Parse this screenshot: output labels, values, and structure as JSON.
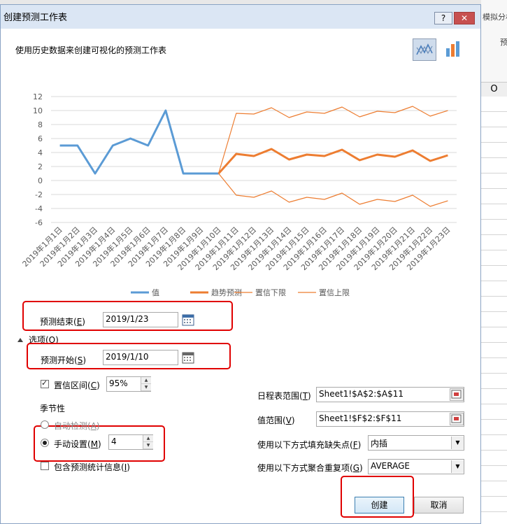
{
  "dialog": {
    "title": "创建预测工作表",
    "help_label": "?",
    "close_label": "✕",
    "subtitle": "使用历史数据来创建可视化的预测工作表"
  },
  "background": {
    "right_labels": [
      "模拟分析",
      "预"
    ],
    "column_header": "O"
  },
  "icons": {
    "line_chart": "line-chart-icon",
    "column_chart": "column-chart-icon",
    "calendar": "calendar-icon",
    "range_ref": "range-select-icon"
  },
  "colors": {
    "value_series": "#5b9bd5",
    "forecast_series": "#ed7d31",
    "highlight_box": "#e00000"
  },
  "chart_data": {
    "type": "line",
    "categories": [
      "2019年1月1日",
      "2019年1月2日",
      "2019年1月3日",
      "2019年1月4日",
      "2019年1月5日",
      "2019年1月6日",
      "2019年1月7日",
      "2019年1月8日",
      "2019年1月9日",
      "2019年1月10日",
      "2019年1月11日",
      "2019年1月12日",
      "2019年1月13日",
      "2019年1月14日",
      "2019年1月15日",
      "2019年1月16日",
      "2019年1月17日",
      "2019年1月18日",
      "2019年1月19日",
      "2019年1月20日",
      "2019年1月21日",
      "2019年1月22日",
      "2019年1月23日"
    ],
    "yticks": [
      "12",
      "10",
      "8",
      "6",
      "4",
      "2",
      "0",
      "-2",
      "-4",
      "-6"
    ],
    "ylim": [
      -6,
      12
    ],
    "series": [
      {
        "name": "值",
        "values": [
          5,
          5,
          1,
          5,
          6,
          5,
          10,
          1,
          1,
          1,
          null,
          null,
          null,
          null,
          null,
          null,
          null,
          null,
          null,
          null,
          null,
          null,
          null
        ]
      },
      {
        "name": "趋势预测",
        "values": [
          null,
          null,
          null,
          null,
          null,
          null,
          null,
          null,
          null,
          1,
          3.8,
          3.5,
          4.5,
          3.0,
          3.7,
          3.5,
          4.4,
          2.9,
          3.7,
          3.4,
          4.3,
          2.8,
          3.6
        ]
      },
      {
        "name": "置信下限",
        "values": [
          null,
          null,
          null,
          null,
          null,
          null,
          null,
          null,
          null,
          1,
          -2.1,
          -2.4,
          -1.5,
          -3.1,
          -2.4,
          -2.7,
          -1.8,
          -3.4,
          -2.7,
          -3.0,
          -2.1,
          -3.7,
          -2.9
        ]
      },
      {
        "name": "置信上限",
        "values": [
          null,
          null,
          null,
          null,
          null,
          null,
          null,
          null,
          null,
          1,
          9.6,
          9.5,
          10.4,
          9.0,
          9.8,
          9.6,
          10.5,
          9.1,
          9.9,
          9.7,
          10.6,
          9.2,
          10.0
        ]
      }
    ],
    "legend_placement": "bottom",
    "grid": true
  },
  "form": {
    "forecast_end_label": "预测结束(",
    "forecast_end_key": "E",
    "forecast_end_value": "2019/1/23",
    "options_label": "选项(O)",
    "forecast_start_label": "预测开始(",
    "forecast_start_key": "S",
    "forecast_start_value": "2019/1/10",
    "confidence_label": "置信区间(",
    "confidence_key": "C",
    "confidence_value": "95%",
    "seasonality_label": "季节性",
    "auto_detect_label": "自动检测(",
    "auto_detect_key": "A",
    "manual_label": "手动设置(",
    "manual_key": "M",
    "manual_value": "4",
    "include_stats_label": "包含预测统计信息(",
    "include_stats_key": "I",
    "close_paren": ")",
    "timeline_label": "日程表范围(",
    "timeline_key": "T",
    "timeline_value": "Sheet1!$A$2:$A$11",
    "values_label": "值范围(",
    "values_key": "V",
    "values_value": "Sheet1!$F$2:$F$11",
    "fill_missing_label": "使用以下方式填充缺失点(",
    "fill_missing_key": "F",
    "fill_missing_value": "内插",
    "aggregate_label": "使用以下方式聚合重复项(",
    "aggregate_key": "G",
    "aggregate_value": "AVERAGE",
    "create_label": "创建",
    "cancel_label": "取消"
  }
}
